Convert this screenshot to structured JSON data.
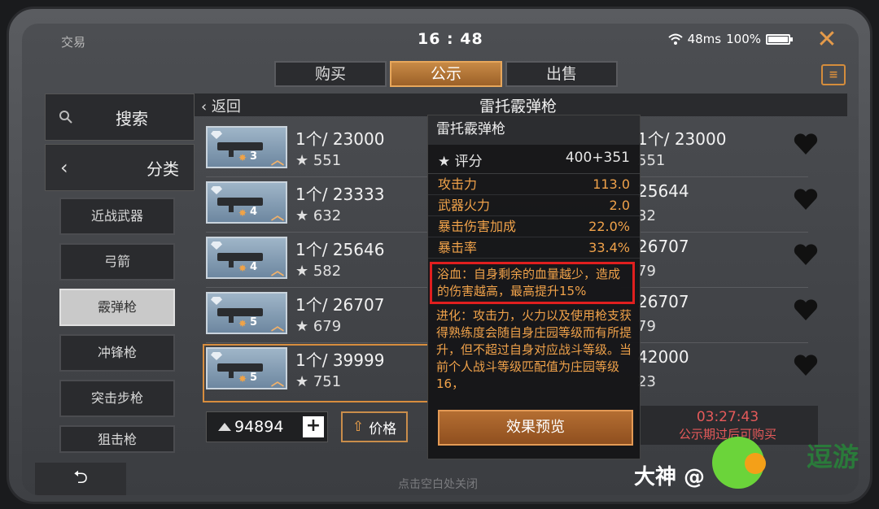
{
  "status": {
    "left": "交易",
    "time": "16 : 48",
    "ping": "48ms",
    "battery": "100%"
  },
  "tabs": [
    {
      "label": "购买",
      "active": false
    },
    {
      "label": "公示",
      "active": true
    },
    {
      "label": "出售",
      "active": false
    }
  ],
  "sidebar": {
    "search_label": "搜索",
    "category_label": "分类",
    "categories": [
      "近战武器",
      "弓箭",
      "霰弹枪",
      "冲锋枪",
      "突击步枪",
      "狙击枪"
    ],
    "active_category": "霰弹枪"
  },
  "header": {
    "back_label": "返回",
    "title": "雷托霰弹枪"
  },
  "left_list": [
    {
      "level": "3",
      "price": "1个/ 23000",
      "score": "551"
    },
    {
      "level": "4",
      "price": "1个/ 23333",
      "score": "632"
    },
    {
      "level": "4",
      "price": "1个/ 25646",
      "score": "582"
    },
    {
      "level": "5",
      "price": "1个/ 26707",
      "score": "679"
    },
    {
      "level": "5",
      "price": "1个/ 39999",
      "score": "751"
    }
  ],
  "right_list": [
    {
      "price": "1个/ 23000",
      "score": "551"
    },
    {
      "price": "25644",
      "score": "32"
    },
    {
      "price": "26707",
      "score": "79"
    },
    {
      "price": "26707",
      "score": "79"
    },
    {
      "price": "42000",
      "score": "23"
    }
  ],
  "footer": {
    "balance": "94894",
    "sort_label": "价格",
    "countdown": "03:27:43",
    "countdown_note": "公示期过后可购买",
    "hint": "点击空白处关闭"
  },
  "popup": {
    "title": "雷托霰弹枪",
    "score_label": "评分",
    "score_value": "400+351",
    "stats": [
      {
        "label": "攻击力",
        "value": "113.0"
      },
      {
        "label": "武器火力",
        "value": "2.0"
      },
      {
        "label": "暴击伤害加成",
        "value": "22.0%"
      },
      {
        "label": "暴击率",
        "value": "33.4%"
      }
    ],
    "highlight": "浴血：自身剩余的血量越少，造成的伤害越高，最高提升15%",
    "evolution": "进化：攻击力，火力以及使用枪支获得熟练度会随自身庄园等级而有所提升，但不超过自身对应战斗等级。当前个人战斗等级匹配值为庄园等级16，",
    "preview_label": "效果预览"
  },
  "watermark": {
    "text1": "大神 @",
    "text2": "逗游"
  },
  "colors": {
    "accent": "#d78d3e",
    "highlight_border": "#e01f1f",
    "stat_text": "#f0a24a"
  }
}
